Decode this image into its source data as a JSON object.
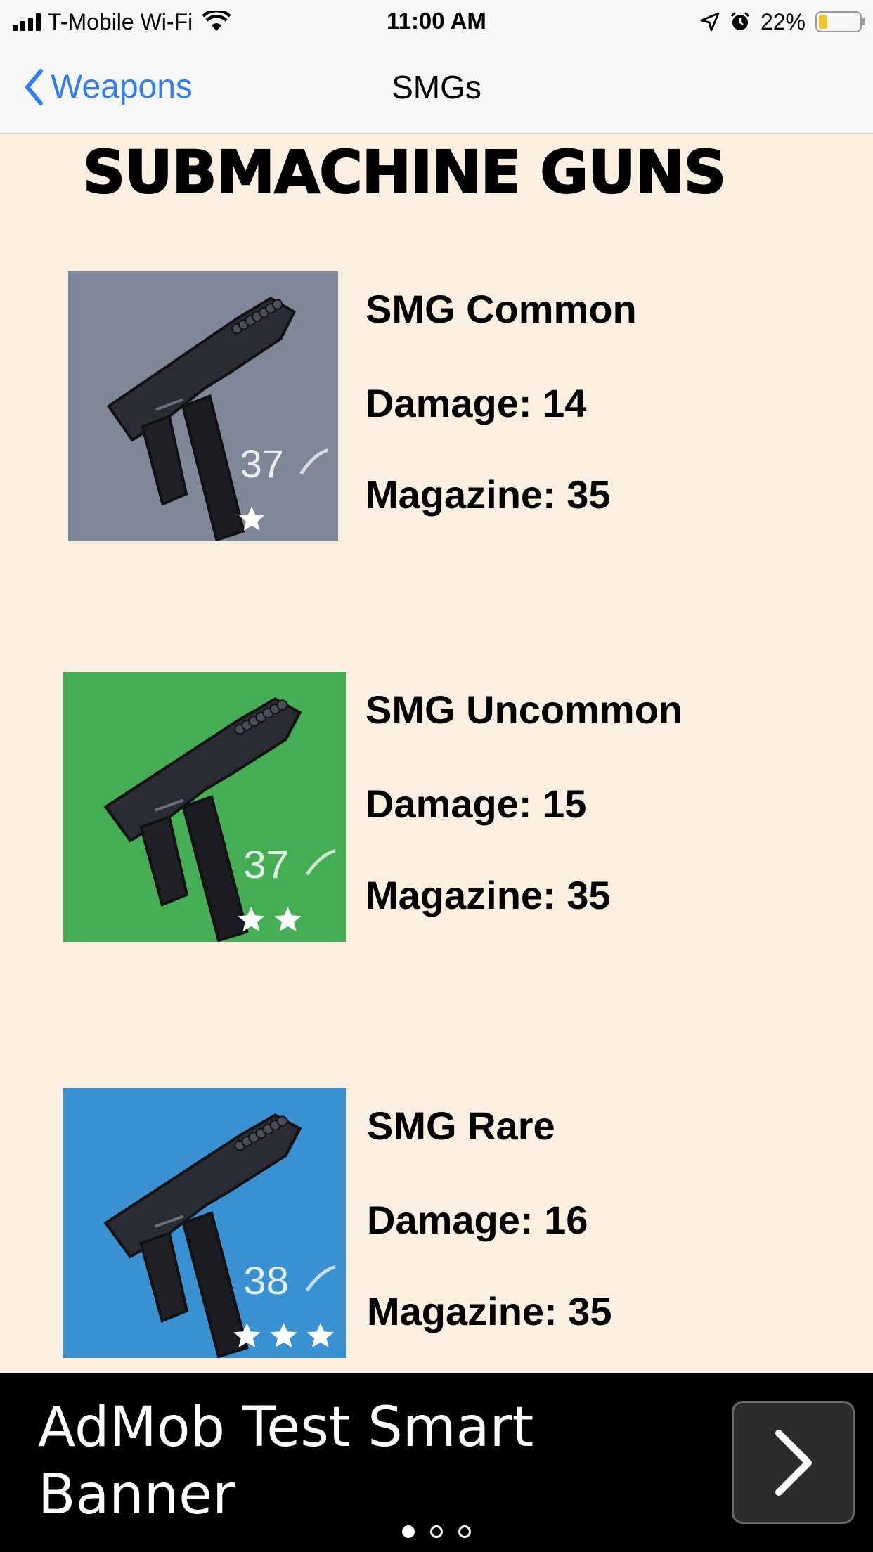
{
  "status_bar": {
    "carrier": "T-Mobile Wi-Fi",
    "time": "11:00 AM",
    "battery": "22%",
    "battery_level": 0.22,
    "icons": [
      "signal-icon",
      "wifi-icon",
      "location-icon",
      "alarm-icon",
      "battery-icon"
    ]
  },
  "nav": {
    "back_label": "Weapons",
    "title": "SMGs"
  },
  "heading": "SUBMACHINE GUNS",
  "weapons": [
    {
      "name": "SMG Common",
      "damage": "Damage: 14",
      "magazine": "Magazine: 35",
      "image_number": "37",
      "stars": 1,
      "color": "#8a93a6"
    },
    {
      "name": "SMG Uncommon",
      "damage": "Damage: 15",
      "magazine": "Magazine: 35",
      "image_number": "37",
      "stars": 2,
      "color": "#4bbd5c"
    },
    {
      "name": "SMG Rare",
      "damage": "Damage: 16",
      "magazine": "Magazine: 35",
      "image_number": "38",
      "stars": 3,
      "color": "#3f9ee3"
    }
  ],
  "ad": {
    "text": "AdMob Test Smart Banner",
    "button_icon": "chevron-right-icon",
    "pages": 3,
    "active_page": 1
  },
  "colors": {
    "background": "#fbefe2",
    "link": "#2f7cf6",
    "battery_fill": "#f2c230"
  }
}
